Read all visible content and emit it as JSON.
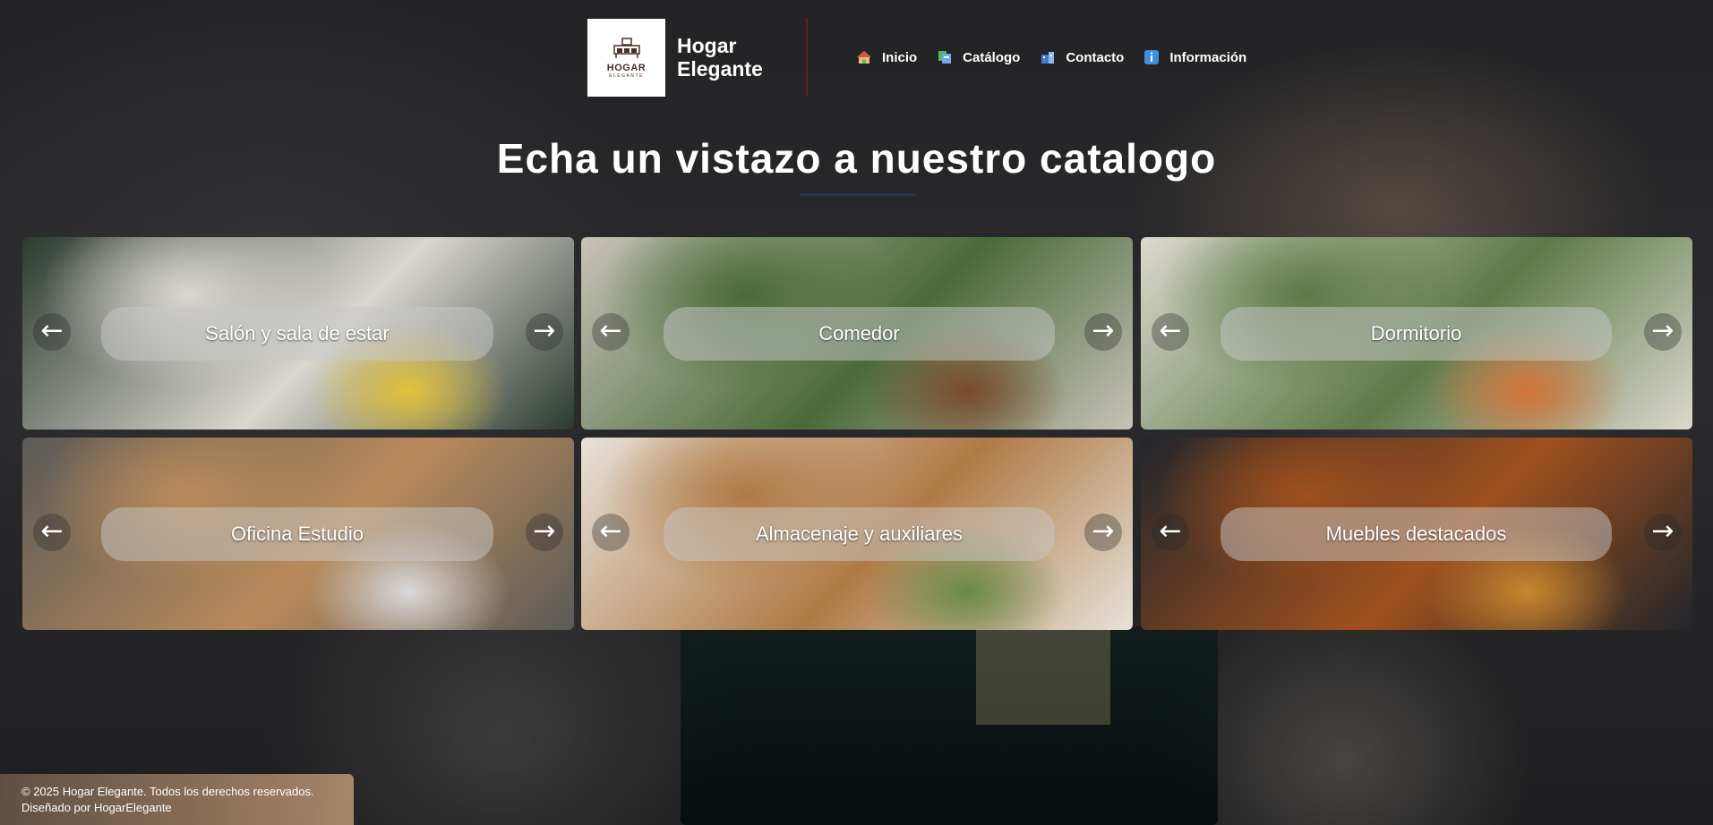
{
  "brand": {
    "logo_word": "HOGAR",
    "logo_sub": "ELEGANTE",
    "name_line1": "Hogar",
    "name_line2": "Elegante"
  },
  "nav": [
    {
      "label": "Inicio",
      "icon": "house-icon"
    },
    {
      "label": "Catálogo",
      "icon": "catalog-icon"
    },
    {
      "label": "Contacto",
      "icon": "contact-icon"
    },
    {
      "label": "Información",
      "icon": "info-icon"
    }
  ],
  "title": "Echa un vistazo a nuestro catalogo",
  "categories": [
    {
      "label": "Salón y sala de estar",
      "colors": [
        "#2c3a30",
        "#d9d6cf",
        "#e2c13a"
      ]
    },
    {
      "label": "Comedor",
      "colors": [
        "#c8c2b8",
        "#4a6a3a",
        "#7a4a2a"
      ]
    },
    {
      "label": "Dormitorio",
      "colors": [
        "#dcd8ce",
        "#5d7a48",
        "#d2733a"
      ]
    },
    {
      "label": "Oficina Estudio",
      "colors": [
        "#5a5a58",
        "#b98a5a",
        "#d9d9d9"
      ]
    },
    {
      "label": "Almacenaje y auxiliares",
      "colors": [
        "#e6e2da",
        "#b07a45",
        "#6a8a4a"
      ]
    },
    {
      "label": "Muebles destacados",
      "colors": [
        "#22262c",
        "#a0501d",
        "#c7872e"
      ]
    }
  ],
  "arrows": {
    "left": "←",
    "right": "→"
  },
  "footer": {
    "line1": "© 2025 Hogar Elegante. Todos los derechos reservados.",
    "line2": "Diseñado por HogarElegante"
  }
}
